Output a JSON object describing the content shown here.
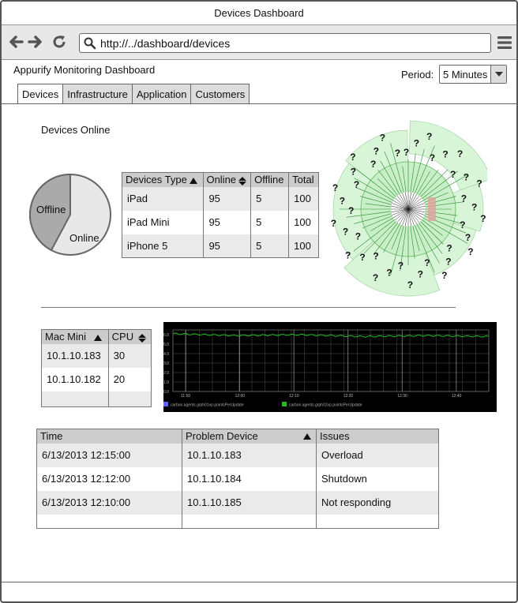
{
  "window": {
    "title": "Devices Dashboard"
  },
  "browser": {
    "url": "http://../dashboard/devices"
  },
  "app": {
    "title": "Appurify Monitoring Dashboard"
  },
  "period": {
    "label": "Period:",
    "value": "5 Minutes"
  },
  "tabs": [
    "Devices",
    "Infrastructure",
    "Application",
    "Customers"
  ],
  "devices_online": {
    "title": "Devices Online",
    "pie": {
      "labels": [
        "Offline",
        "Online"
      ],
      "colors": [
        "#aaaaaa",
        "#e8e8e8"
      ],
      "offline_fraction": 0.42
    }
  },
  "devices_table": {
    "headers": [
      "Devices Type",
      "Online",
      "Offline",
      "Total"
    ],
    "rows": [
      [
        "iPad",
        "95",
        "5",
        "100"
      ],
      [
        "iPad Mini",
        "95",
        "5",
        "100"
      ],
      [
        "iPhone 5",
        "95",
        "5",
        "100"
      ]
    ]
  },
  "mac_table": {
    "headers": [
      "Mac Mini",
      "CPU"
    ],
    "rows": [
      [
        "10.1.10.183",
        "30"
      ],
      [
        "10.1.10.182",
        "20"
      ],
      [
        "",
        ""
      ]
    ]
  },
  "chart_data": {
    "type": "line",
    "x": [
      "11:50",
      "12:00",
      "12:10",
      "12:20",
      "12:30",
      "12:40"
    ],
    "yticks": [
      "6.0",
      "5.0",
      "4.0",
      "3.0",
      "2.0",
      "1.0",
      "0.0"
    ],
    "ylim": [
      0,
      6.5
    ],
    "series": [
      {
        "name": "carbon.agents.grph01vp.pointsPerUpdate",
        "color": "#6666ff",
        "values": [
          6.0,
          6.0,
          6.0,
          6.0,
          6.0,
          6.0
        ]
      },
      {
        "name": "carbon.agents.grph02vp.pointsPerUpdate",
        "color": "#22bb22",
        "values": [
          6.1,
          5.9,
          6.0,
          5.8,
          5.9,
          5.8
        ]
      }
    ]
  },
  "problems_table": {
    "headers": [
      "Time",
      "Problem Device",
      "Issues"
    ],
    "rows": [
      [
        "6/13/2013 12:15:00",
        "10.1.10.183",
        "Overload"
      ],
      [
        "6/13/2013 12:12:00",
        "10.1.10.184",
        "Shutdown"
      ],
      [
        "6/13/2013 12:10:00",
        "10.1.10.185",
        "Not responding"
      ],
      [
        "",
        "",
        ""
      ]
    ]
  },
  "colors": {
    "accent_green": "#22bb22",
    "chart_bg": "#000000"
  }
}
